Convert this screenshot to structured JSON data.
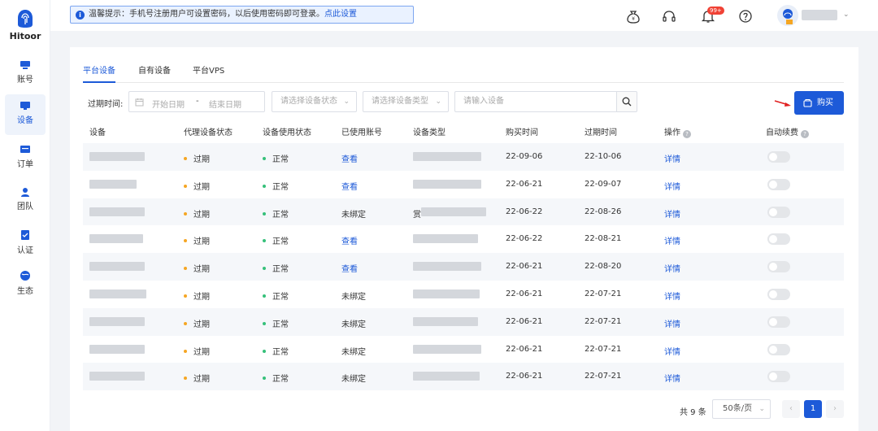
{
  "brand": {
    "name": "Hitoor"
  },
  "sidebar": {
    "items": [
      {
        "label": "账号",
        "icon": "account-icon"
      },
      {
        "label": "设备",
        "icon": "device-icon",
        "active": true
      },
      {
        "label": "订单",
        "icon": "order-icon"
      },
      {
        "label": "团队",
        "icon": "team-icon"
      },
      {
        "label": "认证",
        "icon": "verify-icon"
      },
      {
        "label": "生态",
        "icon": "ecosystem-icon"
      }
    ]
  },
  "topbar": {
    "notice_text": "温馨提示：手机号注册用户可设置密码，以后使用密码即可登录。",
    "notice_link": "点此设置",
    "notification_badge": "99+"
  },
  "tabs": [
    "平台设备",
    "自有设备",
    "平台VPS"
  ],
  "filters": {
    "expire_label": "过期时间:",
    "date_from_placeholder": "开始日期",
    "date_sep": "-",
    "date_to_placeholder": "结束日期",
    "status_placeholder": "请选择设备状态",
    "type_placeholder": "请选择设备类型",
    "search_placeholder": "请输入设备"
  },
  "buy_button": "购买",
  "table": {
    "columns": [
      "设备",
      "代理设备状态",
      "设备使用状态",
      "已使用账号",
      "设备类型",
      "购买时间",
      "过期时间",
      "操作",
      "自动续费"
    ],
    "rows": [
      {
        "proxy_status": "过期",
        "use_status": "正常",
        "account": "查看",
        "account_link": true,
        "buy": "22-09-06",
        "expire": "22-10-06",
        "action": "详情",
        "type_prefix": ""
      },
      {
        "proxy_status": "过期",
        "use_status": "正常",
        "account": "查看",
        "account_link": true,
        "buy": "22-06-21",
        "expire": "22-09-07",
        "action": "详情",
        "type_prefix": ""
      },
      {
        "proxy_status": "过期",
        "use_status": "正常",
        "account": "未绑定",
        "account_link": false,
        "buy": "22-06-22",
        "expire": "22-08-26",
        "action": "详情",
        "type_prefix": "赏"
      },
      {
        "proxy_status": "过期",
        "use_status": "正常",
        "account": "查看",
        "account_link": true,
        "buy": "22-06-22",
        "expire": "22-08-21",
        "action": "详情",
        "type_prefix": ""
      },
      {
        "proxy_status": "过期",
        "use_status": "正常",
        "account": "查看",
        "account_link": true,
        "buy": "22-06-21",
        "expire": "22-08-20",
        "action": "详情",
        "type_prefix": ""
      },
      {
        "proxy_status": "过期",
        "use_status": "正常",
        "account": "未绑定",
        "account_link": false,
        "buy": "22-06-21",
        "expire": "22-07-21",
        "action": "详情",
        "type_prefix": ""
      },
      {
        "proxy_status": "过期",
        "use_status": "正常",
        "account": "未绑定",
        "account_link": false,
        "buy": "22-06-21",
        "expire": "22-07-21",
        "action": "详情",
        "type_prefix": ""
      },
      {
        "proxy_status": "过期",
        "use_status": "正常",
        "account": "未绑定",
        "account_link": false,
        "buy": "22-06-21",
        "expire": "22-07-21",
        "action": "详情",
        "type_prefix": ""
      },
      {
        "proxy_status": "过期",
        "use_status": "正常",
        "account": "未绑定",
        "account_link": false,
        "buy": "22-06-21",
        "expire": "22-07-21",
        "action": "详情",
        "type_prefix": ""
      }
    ]
  },
  "pagination": {
    "total": "共 9 条",
    "page_size": "50条/页",
    "prev": "‹",
    "current": "1",
    "next": "›"
  },
  "colors": {
    "primary": "#1d5ad8",
    "expired_dot": "#f5a623",
    "normal_dot": "#36c07a"
  }
}
